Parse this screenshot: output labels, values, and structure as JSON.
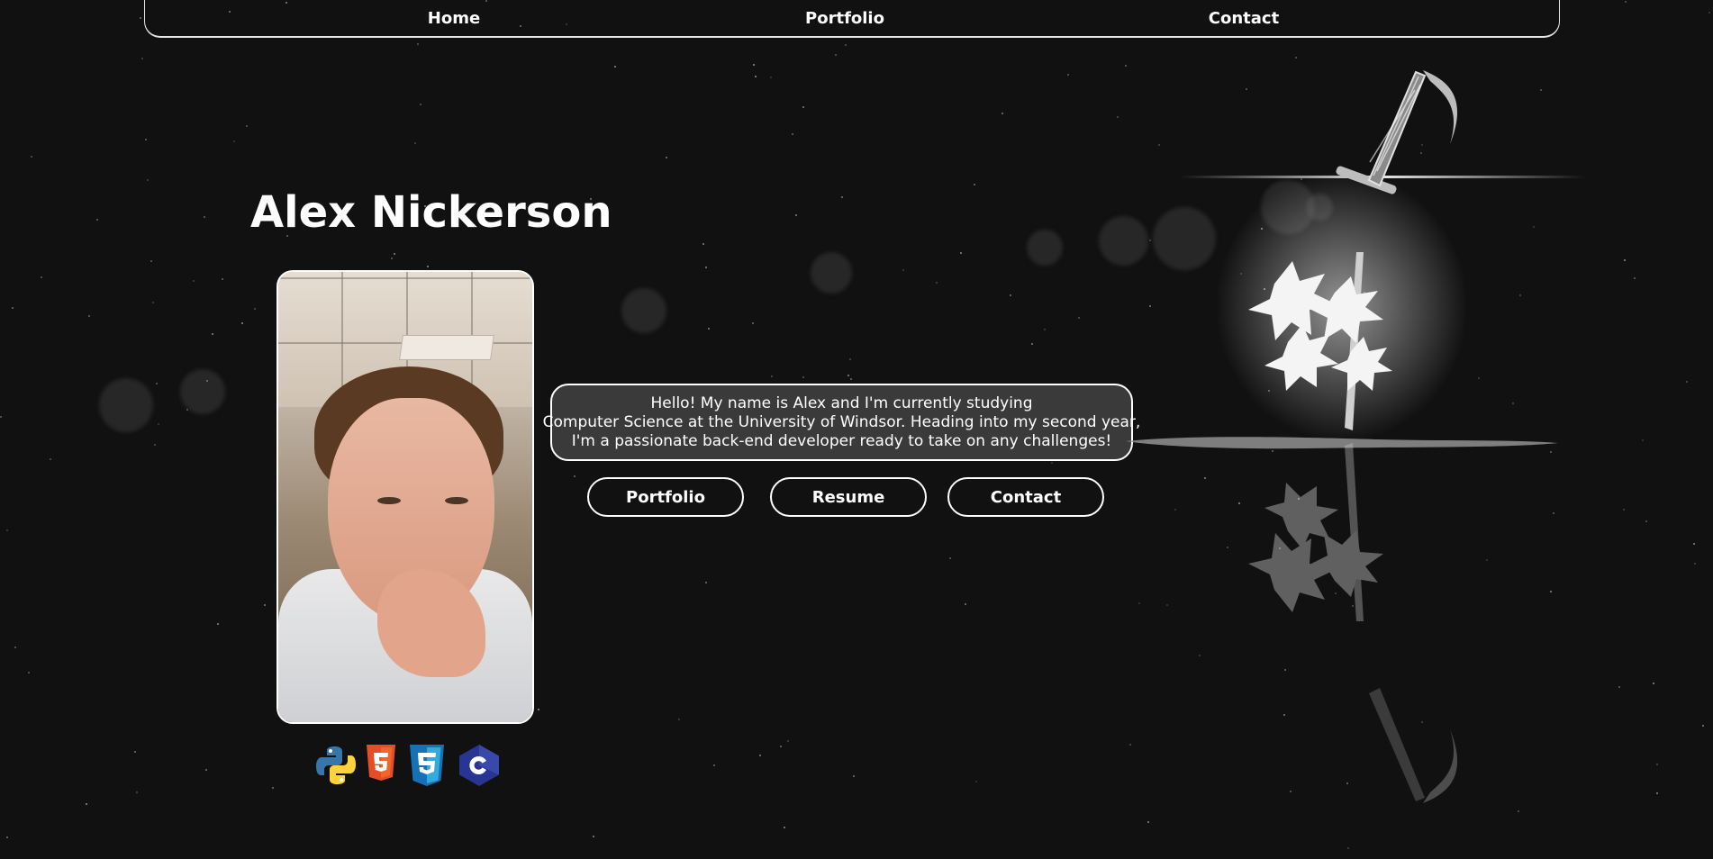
{
  "nav": {
    "home": "Home",
    "portfolio": "Portfolio",
    "contact": "Contact"
  },
  "hero": {
    "name": "Alex Nickerson",
    "bio_lines": [
      "Hello! My name is Alex and I'm currently studying",
      "Computer Science at the University of Windsor. Heading into my second year,",
      "I'm a passionate back-end developer ready to take on any challenges!"
    ]
  },
  "buttons": {
    "portfolio": "Portfolio",
    "resume": "Resume",
    "contact": "Contact"
  },
  "skills": [
    "python-icon",
    "html5-icon",
    "css3-icon",
    "c-icon"
  ],
  "colors": {
    "background": "#111111",
    "panel": "#3a3a3a",
    "border": "#ffffff",
    "python_blue": "#3776ab",
    "python_yellow": "#ffd43b",
    "html5_orange": "#e44d26",
    "css3_blue": "#1572b6",
    "c_blue": "#283593"
  }
}
